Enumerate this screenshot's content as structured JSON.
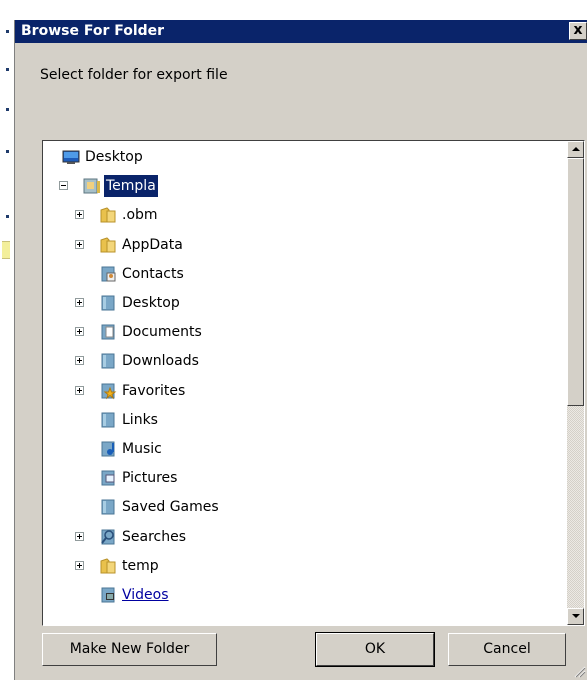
{
  "dialog": {
    "title": "Browse For Folder",
    "close_glyph": "x",
    "prompt": "Select folder for export file"
  },
  "tree": {
    "items": [
      {
        "label": "Desktop",
        "icon": "desktop-icon",
        "expander": "none",
        "selected": false,
        "level": 0
      },
      {
        "label": "Templa",
        "icon": "user-folder-icon",
        "expander": "minus",
        "selected": true,
        "level": 1
      },
      {
        "label": ".obm",
        "icon": "folder-icon",
        "expander": "plus",
        "selected": false,
        "level": 2
      },
      {
        "label": "AppData",
        "icon": "folder-icon",
        "expander": "plus",
        "selected": false,
        "level": 2
      },
      {
        "label": "Contacts",
        "icon": "contacts-folder-icon",
        "expander": "none",
        "selected": false,
        "level": 2
      },
      {
        "label": "Desktop",
        "icon": "desktop-folder-icon",
        "expander": "plus",
        "selected": false,
        "level": 2
      },
      {
        "label": "Documents",
        "icon": "documents-folder-icon",
        "expander": "plus",
        "selected": false,
        "level": 2
      },
      {
        "label": "Downloads",
        "icon": "downloads-folder-icon",
        "expander": "plus",
        "selected": false,
        "level": 2
      },
      {
        "label": "Favorites",
        "icon": "favorites-folder-icon",
        "expander": "plus",
        "selected": false,
        "level": 2
      },
      {
        "label": "Links",
        "icon": "links-folder-icon",
        "expander": "none",
        "selected": false,
        "level": 2
      },
      {
        "label": "Music",
        "icon": "music-folder-icon",
        "expander": "none",
        "selected": false,
        "level": 2
      },
      {
        "label": "Pictures",
        "icon": "pictures-folder-icon",
        "expander": "none",
        "selected": false,
        "level": 2
      },
      {
        "label": "Saved Games",
        "icon": "saved-games-folder-icon",
        "expander": "none",
        "selected": false,
        "level": 2
      },
      {
        "label": "Searches",
        "icon": "searches-folder-icon",
        "expander": "plus",
        "selected": false,
        "level": 2
      },
      {
        "label": "temp",
        "icon": "folder-icon",
        "expander": "plus",
        "selected": false,
        "level": 2
      },
      {
        "label": "Videos",
        "icon": "videos-folder-icon",
        "expander": "none",
        "selected": false,
        "level": 2,
        "link": true
      }
    ]
  },
  "buttons": {
    "make_new_folder": "Make New Folder",
    "ok": "OK",
    "cancel": "Cancel"
  },
  "colors": {
    "titlebar": "#0a246a",
    "selection": "#0a246a",
    "dialog_bg": "#d4d0c8"
  }
}
